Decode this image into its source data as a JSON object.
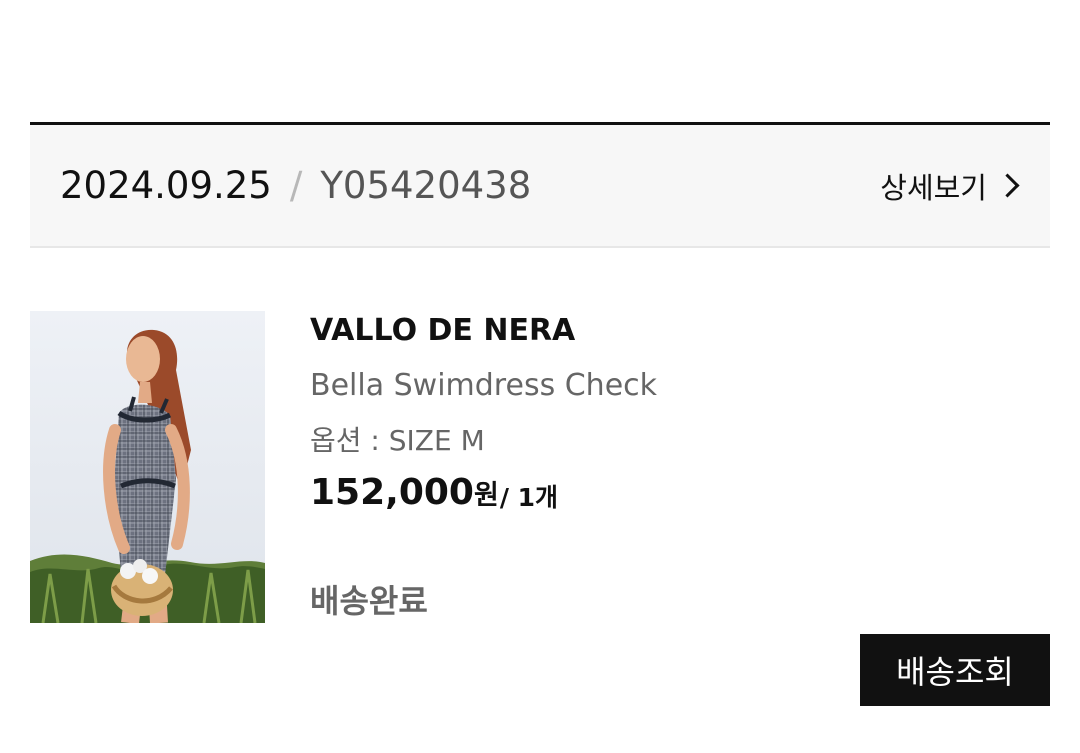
{
  "order": {
    "date": "2024.09.25",
    "separator": "/",
    "number": "Y05420438",
    "detail_label": "상세보기"
  },
  "product": {
    "brand": "VALLO DE NERA",
    "name": "Bella Swimdress Check",
    "option_label": "옵션 : ",
    "option_value": "SIZE M",
    "price": "152,000",
    "currency": "원",
    "quantity": "/ 1개",
    "status": "배송완료",
    "track_button_label": "배송조회"
  },
  "colors": {
    "text_primary": "#111111",
    "text_secondary": "#666666",
    "header_background": "#f7f7f7",
    "button_background": "#111111",
    "button_text": "#ffffff",
    "divider": "#e7e7e7"
  },
  "icons": {
    "detail": "chevron-right-icon",
    "product_image": "product-photo-woman-in-check-swimdress"
  }
}
